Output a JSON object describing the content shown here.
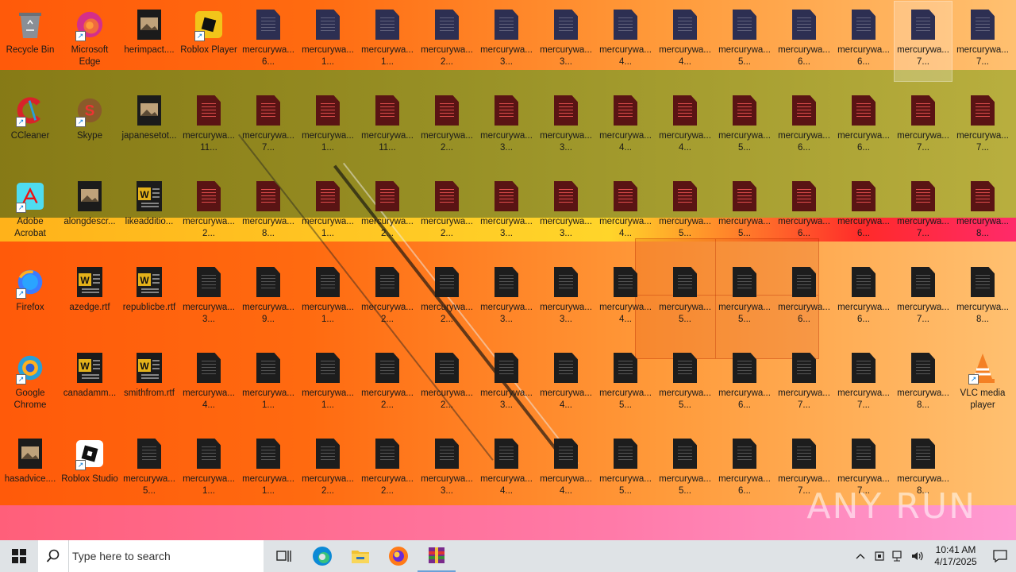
{
  "desktop": {
    "icons": [
      {
        "label": "Recycle Bin",
        "kind": "recycle",
        "selected": false
      },
      {
        "label": "Microsoft Edge",
        "kind": "edge",
        "selected": false
      },
      {
        "label": "herimpact....",
        "kind": "image",
        "selected": false
      },
      {
        "label": "Roblox Player",
        "kind": "roblox-player",
        "selected": false
      },
      {
        "label": "mercurywa... 6...",
        "kind": "doc-blue",
        "selected": false
      },
      {
        "label": "mercurywa... 1...",
        "kind": "doc-blue",
        "selected": false
      },
      {
        "label": "mercurywa... 1...",
        "kind": "doc-blue",
        "selected": false
      },
      {
        "label": "mercurywa... 2...",
        "kind": "doc-blue",
        "selected": false
      },
      {
        "label": "mercurywa... 3...",
        "kind": "doc-blue",
        "selected": false
      },
      {
        "label": "mercurywa... 3...",
        "kind": "doc-blue",
        "selected": false
      },
      {
        "label": "mercurywa... 4...",
        "kind": "doc-blue",
        "selected": false
      },
      {
        "label": "mercurywa... 4...",
        "kind": "doc-blue",
        "selected": false
      },
      {
        "label": "mercurywa... 5...",
        "kind": "doc-blue",
        "selected": false
      },
      {
        "label": "mercurywa... 6...",
        "kind": "doc-blue",
        "selected": false
      },
      {
        "label": "mercurywa... 6...",
        "kind": "doc-blue",
        "selected": false
      },
      {
        "label": "mercurywa... 7...",
        "kind": "doc-blue",
        "selected": true
      },
      {
        "label": "mercurywa... 7...",
        "kind": "doc-blue",
        "selected": false
      },
      {
        "label": "CCleaner",
        "kind": "ccleaner",
        "selected": false
      },
      {
        "label": "Skype",
        "kind": "skype",
        "selected": false
      },
      {
        "label": "japanesetot...",
        "kind": "image",
        "selected": false
      },
      {
        "label": "mercurywa... 11...",
        "kind": "doc-red",
        "selected": false
      },
      {
        "label": "mercurywa... 7...",
        "kind": "doc-red",
        "selected": false
      },
      {
        "label": "mercurywa... 1...",
        "kind": "doc-red",
        "selected": false
      },
      {
        "label": "mercurywa... 11...",
        "kind": "doc-red",
        "selected": false
      },
      {
        "label": "mercurywa... 2...",
        "kind": "doc-red",
        "selected": false
      },
      {
        "label": "mercurywa... 3...",
        "kind": "doc-red",
        "selected": false
      },
      {
        "label": "mercurywa... 3...",
        "kind": "doc-red",
        "selected": false
      },
      {
        "label": "mercurywa... 4...",
        "kind": "doc-red",
        "selected": false
      },
      {
        "label": "mercurywa... 4...",
        "kind": "doc-red",
        "selected": false
      },
      {
        "label": "mercurywa... 5...",
        "kind": "doc-red",
        "selected": false
      },
      {
        "label": "mercurywa... 6...",
        "kind": "doc-red",
        "selected": false
      },
      {
        "label": "mercurywa... 6...",
        "kind": "doc-red",
        "selected": false
      },
      {
        "label": "mercurywa... 7...",
        "kind": "doc-red",
        "selected": false
      },
      {
        "label": "mercurywa... 7...",
        "kind": "doc-red",
        "selected": false
      },
      {
        "label": "Adobe Acrobat",
        "kind": "acrobat",
        "selected": false
      },
      {
        "label": "alongdescr...",
        "kind": "image",
        "selected": false
      },
      {
        "label": "likeadditio...",
        "kind": "word",
        "selected": false
      },
      {
        "label": "mercurywa... 2...",
        "kind": "doc-red",
        "selected": false
      },
      {
        "label": "mercurywa... 8...",
        "kind": "doc-red",
        "selected": false
      },
      {
        "label": "mercurywa... 1...",
        "kind": "doc-red",
        "selected": false
      },
      {
        "label": "mercurywa... 2...",
        "kind": "doc-red",
        "selected": false
      },
      {
        "label": "mercurywa... 2...",
        "kind": "doc-red",
        "selected": false
      },
      {
        "label": "mercurywa... 3...",
        "kind": "doc-red",
        "selected": false
      },
      {
        "label": "mercurywa... 3...",
        "kind": "doc-red",
        "selected": false
      },
      {
        "label": "mercurywa... 4...",
        "kind": "doc-red",
        "selected": false
      },
      {
        "label": "mercurywa... 5...",
        "kind": "doc-red",
        "selected": false
      },
      {
        "label": "mercurywa... 5...",
        "kind": "doc-red",
        "selected": false
      },
      {
        "label": "mercurywa... 6...",
        "kind": "doc-red",
        "selected": false
      },
      {
        "label": "mercurywa... 6...",
        "kind": "doc-red",
        "selected": false
      },
      {
        "label": "mercurywa... 7...",
        "kind": "doc-red",
        "selected": false
      },
      {
        "label": "mercurywa... 8...",
        "kind": "doc-red",
        "selected": false
      },
      {
        "label": "Firefox",
        "kind": "firefox",
        "selected": false
      },
      {
        "label": "azedge.rtf",
        "kind": "word",
        "selected": false
      },
      {
        "label": "republicbe.rtf",
        "kind": "word",
        "selected": false
      },
      {
        "label": "mercurywa... 3...",
        "kind": "doc",
        "selected": false
      },
      {
        "label": "mercurywa... 9...",
        "kind": "doc",
        "selected": false
      },
      {
        "label": "mercurywa... 1...",
        "kind": "doc",
        "selected": false
      },
      {
        "label": "mercurywa... 2...",
        "kind": "doc",
        "selected": false
      },
      {
        "label": "mercurywa... 2...",
        "kind": "doc",
        "selected": false
      },
      {
        "label": "mercurywa... 3...",
        "kind": "doc",
        "selected": false
      },
      {
        "label": "mercurywa... 3...",
        "kind": "doc",
        "selected": false
      },
      {
        "label": "mercurywa... 4...",
        "kind": "doc",
        "selected": false
      },
      {
        "label": "mercurywa... 5...",
        "kind": "doc",
        "selected": false
      },
      {
        "label": "mercurywa... 5...",
        "kind": "doc",
        "selected": false
      },
      {
        "label": "mercurywa... 6...",
        "kind": "doc",
        "selected": false
      },
      {
        "label": "mercurywa... 6...",
        "kind": "doc",
        "selected": false
      },
      {
        "label": "mercurywa... 7...",
        "kind": "doc",
        "selected": false
      },
      {
        "label": "mercurywa... 8...",
        "kind": "doc",
        "selected": false
      },
      {
        "label": "Google Chrome",
        "kind": "chrome",
        "selected": false
      },
      {
        "label": "canadamm...",
        "kind": "word",
        "selected": false
      },
      {
        "label": "smithfrom.rtf",
        "kind": "word",
        "selected": false
      },
      {
        "label": "mercurywa... 4...",
        "kind": "doc",
        "selected": false
      },
      {
        "label": "mercurywa... 1...",
        "kind": "doc",
        "selected": false
      },
      {
        "label": "mercurywa... 1...",
        "kind": "doc",
        "selected": false
      },
      {
        "label": "mercurywa... 2...",
        "kind": "doc",
        "selected": false
      },
      {
        "label": "mercurywa... 2...",
        "kind": "doc",
        "selected": false
      },
      {
        "label": "mercurywa... 3...",
        "kind": "doc",
        "selected": false
      },
      {
        "label": "mercurywa... 4...",
        "kind": "doc",
        "selected": false
      },
      {
        "label": "mercurywa... 5...",
        "kind": "doc",
        "selected": false
      },
      {
        "label": "mercurywa... 5...",
        "kind": "doc",
        "selected": false
      },
      {
        "label": "mercurywa... 6...",
        "kind": "doc",
        "selected": false
      },
      {
        "label": "mercurywa... 7...",
        "kind": "doc",
        "selected": false
      },
      {
        "label": "mercurywa... 7...",
        "kind": "doc",
        "selected": false
      },
      {
        "label": "mercurywa... 8...",
        "kind": "doc",
        "selected": false
      },
      {
        "label": "VLC media player",
        "kind": "vlc",
        "selected": false
      },
      {
        "label": "hasadvice....",
        "kind": "image",
        "selected": false
      },
      {
        "label": "Roblox Studio",
        "kind": "roblox-studio",
        "selected": false
      },
      {
        "label": "mercurywa... 5...",
        "kind": "doc",
        "selected": false
      },
      {
        "label": "mercurywa... 1...",
        "kind": "doc",
        "selected": false
      },
      {
        "label": "mercurywa... 1...",
        "kind": "doc",
        "selected": false
      },
      {
        "label": "mercurywa... 2...",
        "kind": "doc",
        "selected": false
      },
      {
        "label": "mercurywa... 2...",
        "kind": "doc",
        "selected": false
      },
      {
        "label": "mercurywa... 3...",
        "kind": "doc",
        "selected": false
      },
      {
        "label": "mercurywa... 4...",
        "kind": "doc",
        "selected": false
      },
      {
        "label": "mercurywa... 4...",
        "kind": "doc",
        "selected": false
      },
      {
        "label": "mercurywa... 5...",
        "kind": "doc",
        "selected": false
      },
      {
        "label": "mercurywa... 5...",
        "kind": "doc",
        "selected": false
      },
      {
        "label": "mercurywa... 6...",
        "kind": "doc",
        "selected": false
      },
      {
        "label": "mercurywa... 7...",
        "kind": "doc",
        "selected": false
      },
      {
        "label": "mercurywa... 7...",
        "kind": "doc",
        "selected": false
      },
      {
        "label": "mercurywa... 8...",
        "kind": "doc",
        "selected": false
      }
    ],
    "columns": 17,
    "watermark": "ANY RUN"
  },
  "taskbar": {
    "search_placeholder": "Type here to search",
    "pinned": [
      "task-view-icon",
      "edge-icon",
      "file-explorer-icon",
      "firefox-icon",
      "winrar-icon"
    ],
    "clock_time": "10:41 AM",
    "clock_date": "4/17/2025"
  },
  "colors": {
    "accent": "#0078d7",
    "taskbar": "#dfe3e6"
  }
}
